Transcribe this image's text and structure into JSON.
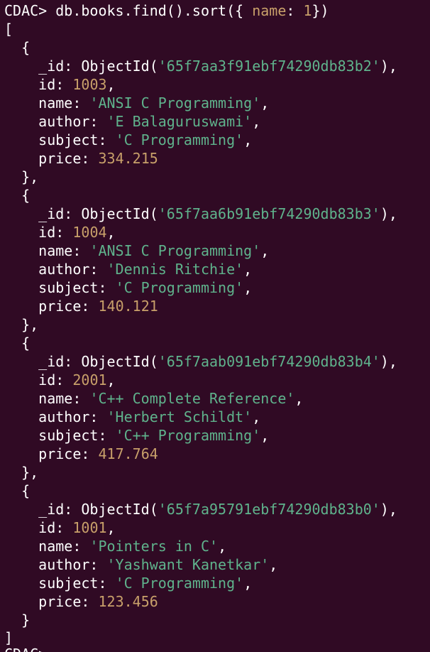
{
  "terminal": {
    "prompt": "CDAC>",
    "command_start": " db.books.find().sort({ ",
    "command_field": "name",
    "command_mid": ": ",
    "command_value": "1",
    "command_end": "})",
    "open_bracket": "[",
    "close_bracket": "]",
    "next_prompt": "CDAC>"
  },
  "records": [
    {
      "oid": "'65f7aa3f91ebf74290db83b2'",
      "id": "1003",
      "name": "'ANSI C Programming'",
      "author": "'E Balaguruswami'",
      "subject": "'C Programming'",
      "price": "334.215"
    },
    {
      "oid": "'65f7aa6b91ebf74290db83b3'",
      "id": "1004",
      "name": "'ANSI C Programming'",
      "author": "'Dennis Ritchie'",
      "subject": "'C Programming'",
      "price": "140.121"
    },
    {
      "oid": "'65f7aab091ebf74290db83b4'",
      "id": "2001",
      "name": "'C++ Complete Reference'",
      "author": "'Herbert Schildt'",
      "subject": "'C++ Programming'",
      "price": "417.764"
    },
    {
      "oid": "'65f7a95791ebf74290db83b0'",
      "id": "1001",
      "name": "'Pointers in C'",
      "author": "'Yashwant Kanetkar'",
      "subject": "'C Programming'",
      "price": "123.456"
    }
  ],
  "keys": {
    "oid_key": "_id",
    "oid_fn": "ObjectId",
    "id_key": "id",
    "name_key": "name",
    "author_key": "author",
    "subject_key": "subject",
    "price_key": "price"
  }
}
